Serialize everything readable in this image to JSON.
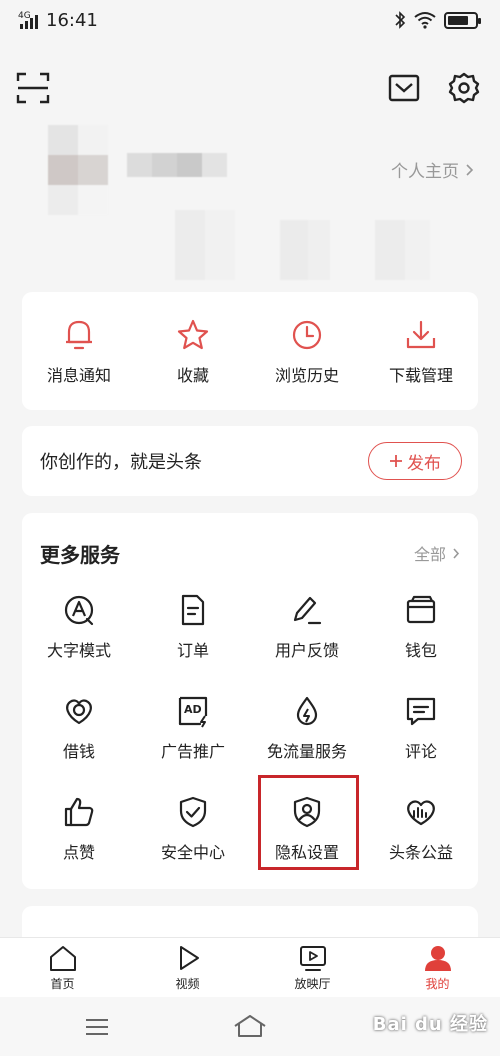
{
  "status_bar": {
    "network": "4G",
    "time": "16:41"
  },
  "profile": {
    "home_link": "个人主页"
  },
  "quick_actions": [
    {
      "label": "消息通知",
      "icon": "bell-icon"
    },
    {
      "label": "收藏",
      "icon": "star-icon"
    },
    {
      "label": "浏览历史",
      "icon": "clock-icon"
    },
    {
      "label": "下载管理",
      "icon": "download-icon"
    }
  ],
  "creator": {
    "text": "你创作的，就是头条",
    "publish_label": "发布"
  },
  "services": {
    "title": "更多服务",
    "all_label": "全部",
    "items": [
      {
        "label": "大字模式",
        "icon": "large-font-icon"
      },
      {
        "label": "订单",
        "icon": "order-icon"
      },
      {
        "label": "用户反馈",
        "icon": "feedback-icon"
      },
      {
        "label": "钱包",
        "icon": "wallet-icon"
      },
      {
        "label": "借钱",
        "icon": "loan-icon"
      },
      {
        "label": "广告推广",
        "icon": "ad-icon"
      },
      {
        "label": "免流量服务",
        "icon": "free-data-icon"
      },
      {
        "label": "评论",
        "icon": "comment-icon"
      },
      {
        "label": "点赞",
        "icon": "thumbs-up-icon"
      },
      {
        "label": "安全中心",
        "icon": "shield-check-icon"
      },
      {
        "label": "隐私设置",
        "icon": "privacy-icon"
      },
      {
        "label": "头条公益",
        "icon": "charity-icon"
      }
    ]
  },
  "tabs": [
    {
      "label": "首页",
      "icon": "home-icon",
      "active": false
    },
    {
      "label": "视频",
      "icon": "video-icon",
      "active": false
    },
    {
      "label": "放映厅",
      "icon": "theater-icon",
      "active": false
    },
    {
      "label": "我的",
      "icon": "profile-icon",
      "active": true
    }
  ],
  "colors": {
    "accent": "#e0524f",
    "highlight_box": "#c8262a",
    "background": "#f5f5f5"
  },
  "watermark": "Bai du 经验"
}
